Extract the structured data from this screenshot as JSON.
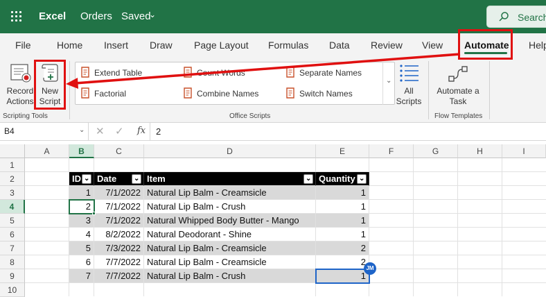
{
  "app": {
    "name": "Excel",
    "doc_title": "Orders",
    "doc_status": "Saved"
  },
  "search": {
    "label": "Search"
  },
  "tabs": [
    "File",
    "Home",
    "Insert",
    "Draw",
    "Page Layout",
    "Formulas",
    "Data",
    "Review",
    "View",
    "Automate",
    "Help"
  ],
  "ribbon": {
    "record_actions": {
      "line1": "Record",
      "line2": "Actions"
    },
    "new_script": {
      "line1": "New",
      "line2": "Script"
    },
    "scripting_tools_label": "Scripting Tools",
    "office_scripts": [
      "Extend Table",
      "Count Words",
      "Separate Names",
      "Factorial",
      "Combine Names",
      "Switch Names"
    ],
    "office_scripts_label": "Office Scripts",
    "all_scripts": {
      "line1": "All",
      "line2": "Scripts"
    },
    "automate_task": {
      "line1": "Automate a",
      "line2": "Task"
    },
    "flow_templates_label": "Flow Templates"
  },
  "formula_bar": {
    "cell_ref": "B4",
    "fx": "fx",
    "value": "2"
  },
  "columns": [
    "A",
    "B",
    "C",
    "D",
    "E",
    "F",
    "G",
    "H",
    "I"
  ],
  "rows": [
    "1",
    "2",
    "3",
    "4",
    "5",
    "6",
    "7",
    "8",
    "9",
    "10"
  ],
  "table": {
    "headers": [
      "ID",
      "Date",
      "Item",
      "Quantity"
    ],
    "rows": [
      [
        "1",
        "7/1/2022",
        "Natural Lip Balm - Creamsicle",
        "1"
      ],
      [
        "2",
        "7/1/2022",
        "Natural Lip Balm - Crush",
        "1"
      ],
      [
        "3",
        "7/1/2022",
        "Natural Whipped Body Butter - Mango",
        "1"
      ],
      [
        "4",
        "8/2/2022",
        "Natural Deodorant - Shine",
        "1"
      ],
      [
        "5",
        "7/3/2022",
        "Natural Lip Balm - Creamsicle",
        "2"
      ],
      [
        "6",
        "7/7/2022",
        "Natural Lip Balm - Creamsicle",
        "2"
      ],
      [
        "7",
        "7/7/2022",
        "Natural Lip Balm - Crush",
        "1"
      ]
    ]
  },
  "collaborator": {
    "initials": "JM"
  },
  "colors": {
    "brand": "#217346",
    "annotation": "#e01010",
    "band": "#d9d9d9",
    "collab": "#1e64c8"
  },
  "icons": [
    "app-launcher-icon",
    "search-icon",
    "record-actions-icon",
    "new-script-icon",
    "script-icon",
    "all-scripts-icon",
    "automate-flow-icon",
    "filter-dropdown-icon"
  ]
}
